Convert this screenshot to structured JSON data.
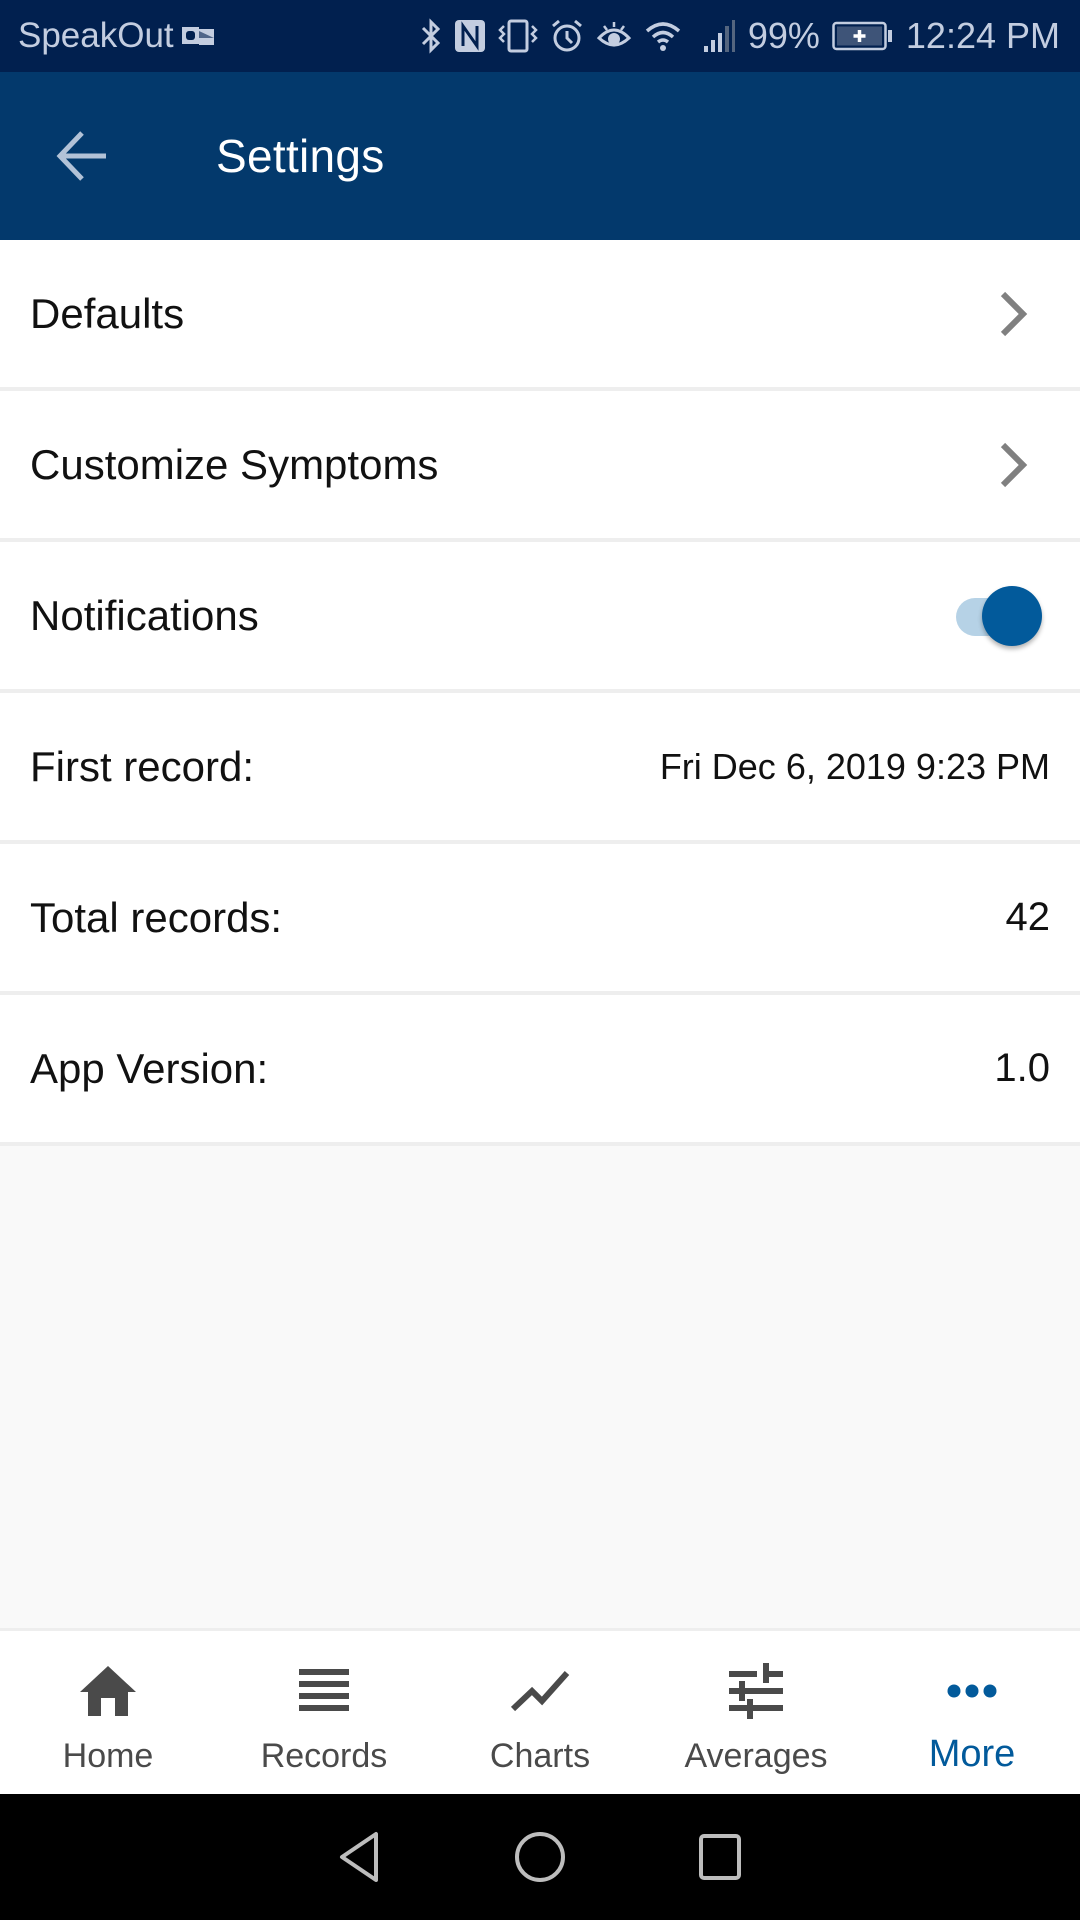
{
  "status_bar": {
    "app_name": "SpeakOut",
    "icons": [
      "outlook-icon",
      "bluetooth-icon",
      "nfc-icon",
      "vibrate-icon",
      "alarm-icon",
      "eye-comfort-icon",
      "wifi-icon",
      "signal-icon",
      "battery-charging-icon"
    ],
    "battery_percent": "99%",
    "time": "12:24 PM"
  },
  "app_bar": {
    "title": "Settings",
    "back_icon": "arrow-left-icon"
  },
  "settings": {
    "defaults": {
      "label": "Defaults",
      "icon": "chevron-right-icon"
    },
    "customize_symptoms": {
      "label": "Customize Symptoms",
      "icon": "chevron-right-icon"
    },
    "notifications": {
      "label": "Notifications",
      "toggle_on": true
    },
    "first_record": {
      "label": "First record:",
      "value": "Fri Dec 6, 2019 9:23 PM"
    },
    "total_records": {
      "label": "Total records:",
      "value": "42"
    },
    "app_version": {
      "label": "App Version:",
      "value": "1.0"
    }
  },
  "bottom_nav": {
    "active": "More",
    "items": [
      {
        "label": "Home",
        "icon": "home-icon"
      },
      {
        "label": "Records",
        "icon": "list-icon"
      },
      {
        "label": "Charts",
        "icon": "trend-line-icon"
      },
      {
        "label": "Averages",
        "icon": "sliders-icon"
      },
      {
        "label": "More",
        "icon": "more-horizontal-icon"
      }
    ]
  },
  "system_nav": {
    "buttons": [
      "back",
      "home",
      "recents"
    ]
  },
  "colors": {
    "status_bar_bg": "#01204f",
    "app_bar_bg": "#03396c",
    "accent": "#025a9b",
    "toggle_track": "#b6d2e6",
    "divider": "#eeeeee",
    "background": "#f9f9f9",
    "nav_icon": "#4a4a4a"
  }
}
